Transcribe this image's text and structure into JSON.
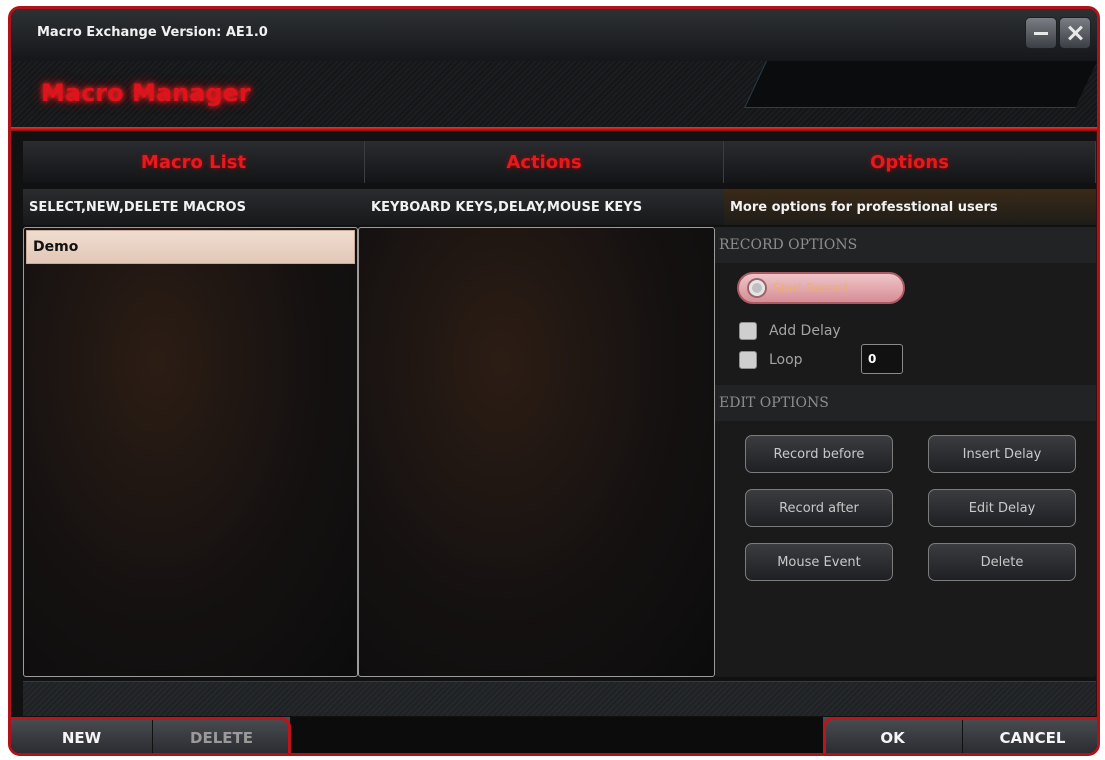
{
  "window": {
    "title": "Macro Exchange Version: AE1.0",
    "app_title": "Macro Manager"
  },
  "columns": {
    "macro_list": {
      "header": "Macro List",
      "subheader": "SELECT,NEW,DELETE MACROS",
      "items": [
        "Demo"
      ]
    },
    "actions": {
      "header": "Actions",
      "subheader": "KEYBOARD KEYS,DELAY,MOUSE KEYS"
    },
    "options": {
      "header": "Options",
      "subheader": "More options for professtional users",
      "record_section": "RECORD OPTIONS",
      "record_button": "Start Record",
      "add_delay_label": "Add Delay",
      "loop_label": "Loop",
      "loop_value": "0",
      "edit_section": "EDIT OPTIONS",
      "buttons": {
        "record_before": "Record before",
        "insert_delay": "Insert Delay",
        "record_after": "Record after",
        "edit_delay": "Edit Delay",
        "mouse_event": "Mouse Event",
        "delete": "Delete"
      }
    }
  },
  "bottom": {
    "new": "NEW",
    "delete": "DELETE",
    "ok": "OK",
    "cancel": "CANCEL"
  },
  "colors": {
    "accent_red": "#e0121b",
    "list_selected": "#e8d2c3"
  }
}
